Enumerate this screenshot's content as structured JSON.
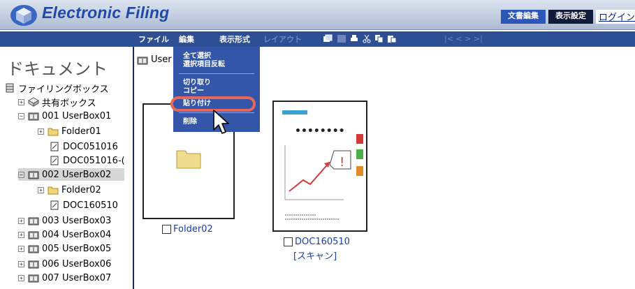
{
  "app": {
    "title": "Electronic Filing"
  },
  "header": {
    "btn_edit_doc": "文書編集",
    "btn_display_settings": "表示設定",
    "btn_logout": "ログイン"
  },
  "menubar": {
    "file": "ファイル",
    "edit": "編集",
    "view": "表示形式",
    "layout": "レイアウト",
    "nav": "|< < > >|"
  },
  "sidebar": {
    "heading": "ドキュメント",
    "tree": [
      {
        "label": "ファイリングボックス"
      },
      {
        "label": "共有ボックス"
      },
      {
        "label": "001 UserBox01"
      },
      {
        "label": "Folder01"
      },
      {
        "label": "DOC051016"
      },
      {
        "label": "DOC051016-("
      },
      {
        "label": "002 UserBox02"
      },
      {
        "label": "Folder02"
      },
      {
        "label": "DOC160510"
      },
      {
        "label": "003 UserBox03"
      },
      {
        "label": "004 UserBox04"
      },
      {
        "label": "005 UserBox05"
      },
      {
        "label": "006 UserBox06"
      },
      {
        "label": "007 UserBox07"
      }
    ]
  },
  "content": {
    "path": "User",
    "items": [
      {
        "label": "Folder02"
      },
      {
        "label": "DOC160510",
        "sublabel": "[スキャン]"
      }
    ]
  },
  "edit_menu": {
    "select_all": "全て選択",
    "invert_selection": "選択項目反転",
    "cut": "切り取り",
    "copy": "コピー",
    "paste": "貼り付け",
    "delete": "削除"
  }
}
